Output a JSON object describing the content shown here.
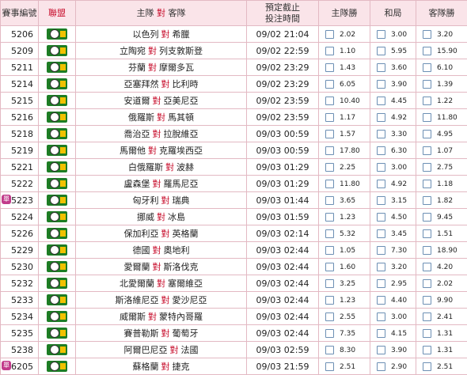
{
  "header": {
    "id": "賽事編號",
    "league": "聯盟",
    "home": "主隊",
    "vs": "對",
    "away": "客隊",
    "deadline_line1": "預定截止",
    "deadline_line2": "投注時間",
    "home_win": "主隊勝",
    "draw": "和局",
    "away_win": "客隊勝"
  },
  "promo_badge": "單",
  "rows": [
    {
      "id": "5206",
      "home": "以色列",
      "away": "希臘",
      "time": "09/02 21:04",
      "h": "2.02",
      "d": "3.00",
      "a": "3.20",
      "promo": false
    },
    {
      "id": "5209",
      "home": "立陶宛",
      "away": "列支敦斯登",
      "time": "09/02 22:59",
      "h": "1.10",
      "d": "5.95",
      "a": "15.90",
      "promo": false
    },
    {
      "id": "5211",
      "home": "芬蘭",
      "away": "摩爾多瓦",
      "time": "09/02 23:29",
      "h": "1.43",
      "d": "3.60",
      "a": "6.10",
      "promo": false
    },
    {
      "id": "5214",
      "home": "亞塞拜然",
      "away": "比利時",
      "time": "09/02 23:29",
      "h": "6.05",
      "d": "3.90",
      "a": "1.39",
      "promo": false
    },
    {
      "id": "5215",
      "home": "安道爾",
      "away": "亞美尼亞",
      "time": "09/02 23:59",
      "h": "10.40",
      "d": "4.45",
      "a": "1.22",
      "promo": false
    },
    {
      "id": "5216",
      "home": "俄羅斯",
      "away": "馬其頓",
      "time": "09/02 23:59",
      "h": "1.17",
      "d": "4.92",
      "a": "11.80",
      "promo": false
    },
    {
      "id": "5218",
      "home": "喬治亞",
      "away": "拉脫維亞",
      "time": "09/03 00:59",
      "h": "1.57",
      "d": "3.30",
      "a": "4.95",
      "promo": false
    },
    {
      "id": "5219",
      "home": "馬爾他",
      "away": "克羅埃西亞",
      "time": "09/03 00:59",
      "h": "17.80",
      "d": "6.30",
      "a": "1.07",
      "promo": false
    },
    {
      "id": "5221",
      "home": "白俄羅斯",
      "away": "波赫",
      "time": "09/03 01:29",
      "h": "2.25",
      "d": "3.00",
      "a": "2.75",
      "promo": false
    },
    {
      "id": "5222",
      "home": "盧森堡",
      "away": "羅馬尼亞",
      "time": "09/03 01:29",
      "h": "11.80",
      "d": "4.92",
      "a": "1.18",
      "promo": false
    },
    {
      "id": "5223",
      "home": "匈牙利",
      "away": "瑞典",
      "time": "09/03 01:44",
      "h": "3.65",
      "d": "3.15",
      "a": "1.82",
      "promo": true
    },
    {
      "id": "5224",
      "home": "挪威",
      "away": "冰島",
      "time": "09/03 01:59",
      "h": "1.23",
      "d": "4.50",
      "a": "9.45",
      "promo": false
    },
    {
      "id": "5226",
      "home": "保加利亞",
      "away": "英格蘭",
      "time": "09/03 02:14",
      "h": "5.32",
      "d": "3.45",
      "a": "1.51",
      "promo": false
    },
    {
      "id": "5229",
      "home": "德國",
      "away": "奧地利",
      "time": "09/03 02:44",
      "h": "1.05",
      "d": "7.30",
      "a": "18.90",
      "promo": false
    },
    {
      "id": "5230",
      "home": "愛爾蘭",
      "away": "斯洛伐克",
      "time": "09/03 02:44",
      "h": "1.60",
      "d": "3.20",
      "a": "4.20",
      "promo": false
    },
    {
      "id": "5232",
      "home": "北愛爾蘭",
      "away": "塞爾維亞",
      "time": "09/03 02:44",
      "h": "3.25",
      "d": "2.95",
      "a": "2.02",
      "promo": false
    },
    {
      "id": "5233",
      "home": "斯洛維尼亞",
      "away": "愛沙尼亞",
      "time": "09/03 02:44",
      "h": "1.23",
      "d": "4.40",
      "a": "9.90",
      "promo": false
    },
    {
      "id": "5234",
      "home": "威爾斯",
      "away": "蒙特內哥羅",
      "time": "09/03 02:44",
      "h": "2.55",
      "d": "3.00",
      "a": "2.41",
      "promo": false
    },
    {
      "id": "5235",
      "home": "賽普勒斯",
      "away": "葡萄牙",
      "time": "09/03 02:44",
      "h": "7.35",
      "d": "4.15",
      "a": "1.31",
      "promo": false
    },
    {
      "id": "5238",
      "home": "阿爾巴尼亞",
      "away": "法國",
      "time": "09/03 02:59",
      "h": "8.30",
      "d": "3.90",
      "a": "1.31",
      "promo": false
    },
    {
      "id": "6205",
      "home": "蘇格蘭",
      "away": "捷克",
      "time": "09/03 21:59",
      "h": "2.51",
      "d": "2.90",
      "a": "2.51",
      "promo": true
    }
  ]
}
